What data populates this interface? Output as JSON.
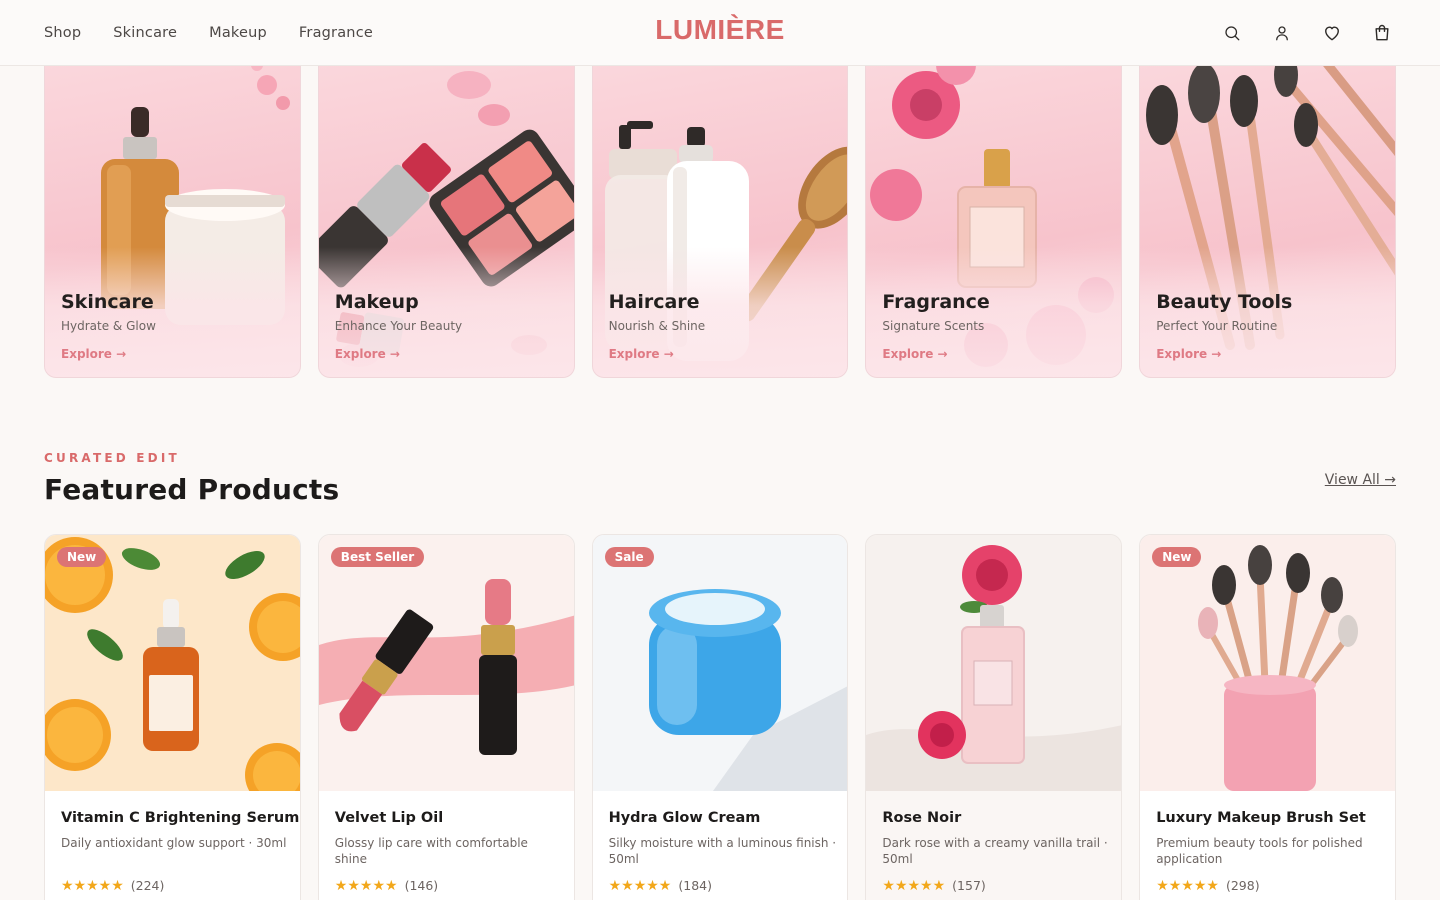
{
  "header": {
    "nav": [
      "Shop",
      "Skincare",
      "Makeup",
      "Fragrance"
    ],
    "logo": "LUMIÈRE",
    "icons": [
      "search-icon",
      "user-icon",
      "heart-icon",
      "cart-icon"
    ]
  },
  "categories": [
    {
      "title": "Skincare",
      "subtitle": "Hydrate & Glow",
      "link": "Explore →"
    },
    {
      "title": "Makeup",
      "subtitle": "Enhance Your Beauty",
      "link": "Explore →"
    },
    {
      "title": "Haircare",
      "subtitle": "Nourish & Shine",
      "link": "Explore →"
    },
    {
      "title": "Fragrance",
      "subtitle": "Signature Scents",
      "link": "Explore →"
    },
    {
      "title": "Beauty Tools",
      "subtitle": "Perfect Your Routine",
      "link": "Explore →"
    }
  ],
  "featured": {
    "eyebrow": "CURATED EDIT",
    "title": "Featured Products",
    "view_all": "View All →"
  },
  "products": [
    {
      "badge": "New",
      "name": "Vitamin C Brightening Serum",
      "desc": "Daily antioxidant glow support · 30ml",
      "stars": "★★★★★",
      "reviews": "(224)"
    },
    {
      "badge": "Best Seller",
      "name": "Velvet Lip Oil",
      "desc": "Glossy lip care with comfortable shine",
      "stars": "★★★★★",
      "reviews": "(146)"
    },
    {
      "badge": "Sale",
      "name": "Hydra Glow Cream",
      "desc": "Silky moisture with a luminous finish · 50ml",
      "stars": "★★★★★",
      "reviews": "(184)"
    },
    {
      "badge": "",
      "name": "Rose Noir",
      "desc": "Dark rose with a creamy vanilla trail · 50ml",
      "stars": "★★★★★",
      "reviews": "(157)"
    },
    {
      "badge": "New",
      "name": "Luxury Makeup Brush Set",
      "desc": "Premium beauty tools for polished application",
      "stars": "★★★★★",
      "reviews": "(298)"
    }
  ],
  "colors": {
    "accent": "#d96a6a",
    "badge": "#dc7474",
    "star": "#f2a71a",
    "background": "#fbf8f6"
  }
}
